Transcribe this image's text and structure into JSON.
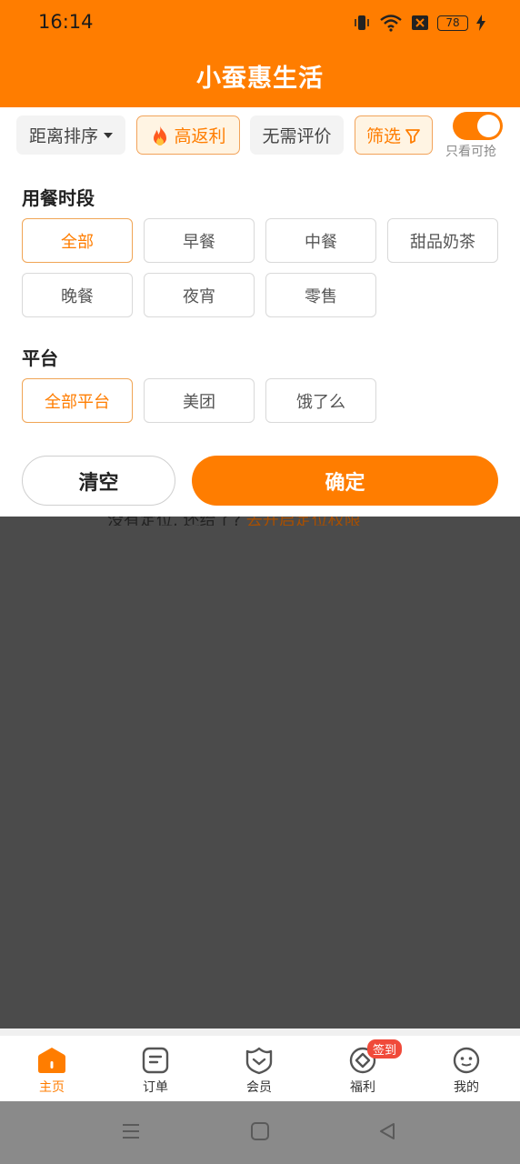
{
  "status_bar": {
    "time": "16:14",
    "battery": "78"
  },
  "header": {
    "title": "小蚕惠生活"
  },
  "filter_bar": {
    "sort_label": "距离排序",
    "rebate_label": "高返利",
    "no_review_label": "无需评价",
    "filter_label": "筛选",
    "toggle_label": "只看可抢"
  },
  "meal_section": {
    "title": "用餐时段",
    "options": [
      "全部",
      "早餐",
      "中餐",
      "甜品奶茶",
      "晚餐",
      "夜宵",
      "零售"
    ],
    "selected": "全部"
  },
  "platform_section": {
    "title": "平台",
    "options": [
      "全部平台",
      "美团",
      "饿了么"
    ],
    "selected": "全部平台"
  },
  "actions": {
    "clear_label": "清空",
    "confirm_label": "确定"
  },
  "location_tip": {
    "text": "没有定位, 还给了?",
    "link": "去开启定位权限"
  },
  "tab_bar": {
    "tabs": [
      {
        "label": "主页",
        "icon": "home-icon"
      },
      {
        "label": "订单",
        "icon": "order-icon"
      },
      {
        "label": "会员",
        "icon": "member-icon"
      },
      {
        "label": "福利",
        "icon": "welfare-icon"
      },
      {
        "label": "我的",
        "icon": "profile-icon"
      }
    ],
    "welfare_badge": "签到"
  },
  "colors": {
    "accent": "#ff7d00",
    "overlay": "#4b4b4b",
    "badge": "#f04a3a"
  }
}
